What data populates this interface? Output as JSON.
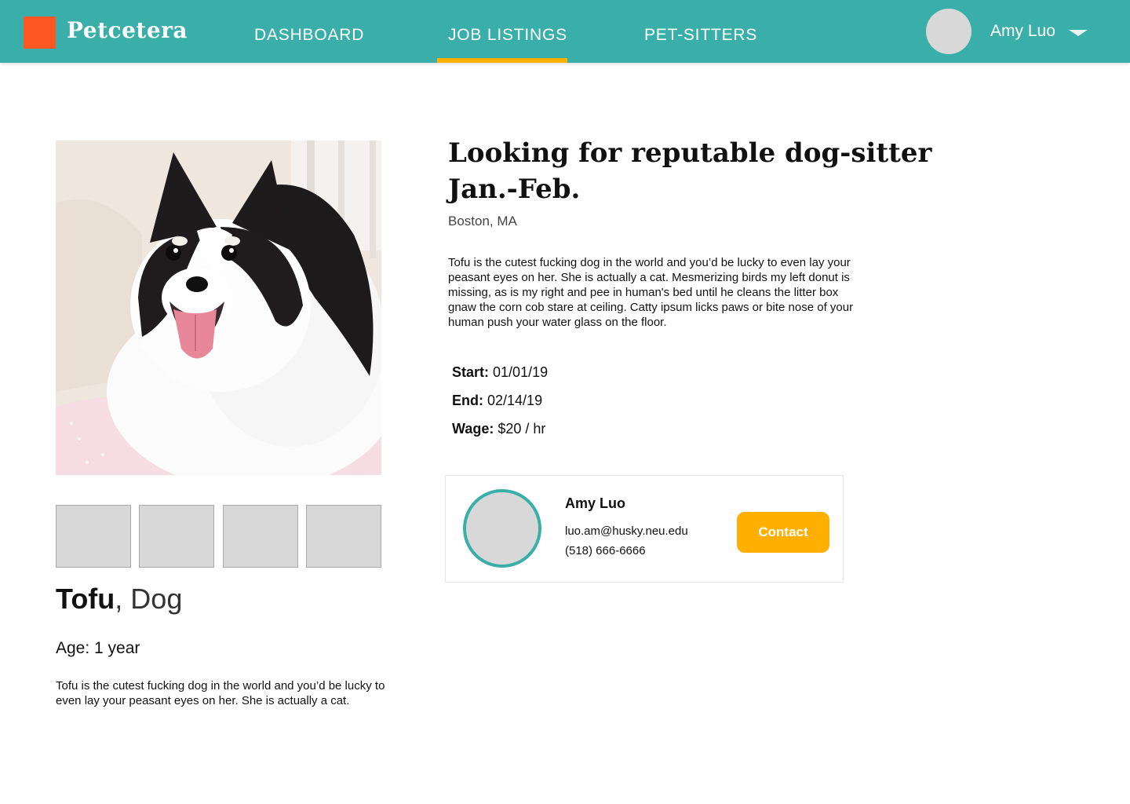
{
  "brand": {
    "name": "Petcetera",
    "logo_color": "#ff5722"
  },
  "colors": {
    "primary": "#3aafaa",
    "accent": "#ffaf00"
  },
  "nav": {
    "links": [
      {
        "label": "DASHBOARD",
        "active": false
      },
      {
        "label": "JOB LISTINGS",
        "active": true
      },
      {
        "label": "PET-SITTERS",
        "active": false
      }
    ],
    "user": {
      "name": "Amy Luo",
      "menu_icon": "chevron-down-icon"
    }
  },
  "pet": {
    "name": "Tofu",
    "species_suffix": ", Dog",
    "age_label": "Age: 1 year",
    "description": "Tofu is the cutest fucking dog in the world and you’d be lucky to even lay your peasant eyes on her. She is actually a cat.",
    "photo": "black-and-white-pomeranian-dog-photo"
  },
  "listing": {
    "title": "Looking for reputable dog-sitter Jan.-Feb.",
    "location": "Boston, MA",
    "description": "Tofu is the cutest fucking dog in the world and you’d be lucky to even lay your peasant eyes on her. She is actually a cat. Mesmerizing birds my left donut is missing, as is my right and pee in human's bed until he cleans the litter box gnaw the corn cob stare at ceiling. Catty ipsum licks paws or bite nose of your human push your water glass on the floor.",
    "start": {
      "label": "Start:",
      "value": "01/01/19"
    },
    "end": {
      "label": "End:",
      "value": "02/14/19"
    },
    "wage": {
      "label": "Wage:",
      "value": "$20 / hr"
    }
  },
  "owner": {
    "name": "Amy Luo",
    "email": "luo.am@husky.neu.edu",
    "phone": "(518) 666-6666",
    "contact_label": "Contact"
  }
}
